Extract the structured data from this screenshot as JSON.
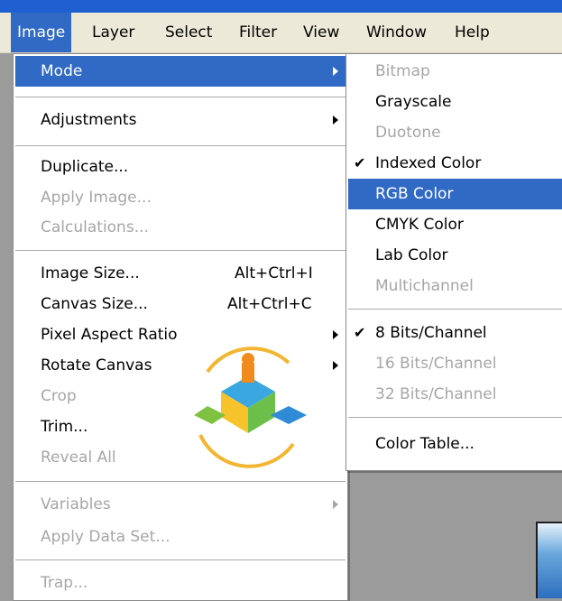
{
  "menubar": {
    "items": [
      "Image",
      "Layer",
      "Select",
      "Filter",
      "View",
      "Window",
      "Help"
    ],
    "active": "Image"
  },
  "image_menu": [
    {
      "label": "Mode",
      "highlighted": true,
      "submenu": true
    },
    {
      "label": "Adjustments",
      "submenu": true
    },
    {
      "label": "Duplicate..."
    },
    {
      "label": "Apply Image...",
      "disabled": true
    },
    {
      "label": "Calculations...",
      "disabled": true
    },
    {
      "label": "Image Size...",
      "shortcut": "Alt+Ctrl+I"
    },
    {
      "label": "Canvas Size...",
      "shortcut": "Alt+Ctrl+C"
    },
    {
      "label": "Pixel Aspect Ratio",
      "submenu": true
    },
    {
      "label": "Rotate Canvas",
      "submenu": true
    },
    {
      "label": "Crop",
      "disabled": true
    },
    {
      "label": "Trim..."
    },
    {
      "label": "Reveal All",
      "disabled": true
    },
    {
      "label": "Variables",
      "disabled": true,
      "submenu": true
    },
    {
      "label": "Apply Data Set...",
      "disabled": true
    },
    {
      "label": "Trap...",
      "disabled": true
    }
  ],
  "mode_submenu": [
    {
      "label": "Bitmap",
      "disabled": true
    },
    {
      "label": "Grayscale"
    },
    {
      "label": "Duotone",
      "disabled": true
    },
    {
      "label": "Indexed Color",
      "checked": true
    },
    {
      "label": "RGB Color",
      "highlighted": true
    },
    {
      "label": "CMYK Color"
    },
    {
      "label": "Lab Color"
    },
    {
      "label": "Multichannel",
      "disabled": true
    },
    {
      "label": "8 Bits/Channel",
      "checked": true
    },
    {
      "label": "16 Bits/Channel",
      "disabled": true
    },
    {
      "label": "32 Bits/Channel",
      "disabled": true
    },
    {
      "label": "Color Table..."
    }
  ],
  "icons": {
    "check": "check-icon",
    "submenu_arrow": "submenu-arrow-icon"
  },
  "colors": {
    "highlight": "#316ac5",
    "menubar": "#ece9d8",
    "disabled_text": "#a6a6a6"
  }
}
